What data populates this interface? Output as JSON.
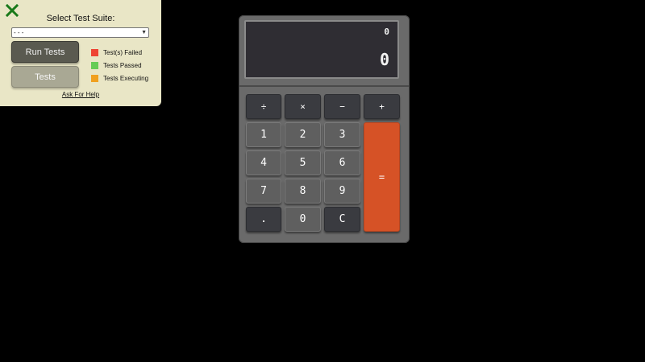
{
  "panel": {
    "close_icon": "close-x-icon",
    "title": "Select Test Suite:",
    "select_value": "- - -",
    "run_button": "Run Tests",
    "tests_button": "Tests",
    "legend": [
      {
        "label": "Test(s) Failed",
        "color": "#ee4433"
      },
      {
        "label": "Tests Passed",
        "color": "#66cc55"
      },
      {
        "label": "Tests Executing",
        "color": "#f0a020"
      }
    ],
    "help_link": "Ask For Help",
    "accent_close": "#1a7a1a"
  },
  "calculator": {
    "expression": "0",
    "value": "0",
    "keys": {
      "divide": "÷",
      "multiply": "×",
      "subtract": "−",
      "add": "+",
      "k1": "1",
      "k2": "2",
      "k3": "3",
      "k4": "4",
      "k5": "5",
      "k6": "6",
      "k7": "7",
      "k8": "8",
      "k9": "9",
      "decimal": ".",
      "k0": "0",
      "clear": "C",
      "equals": "="
    },
    "equals_color": "#d65226"
  }
}
